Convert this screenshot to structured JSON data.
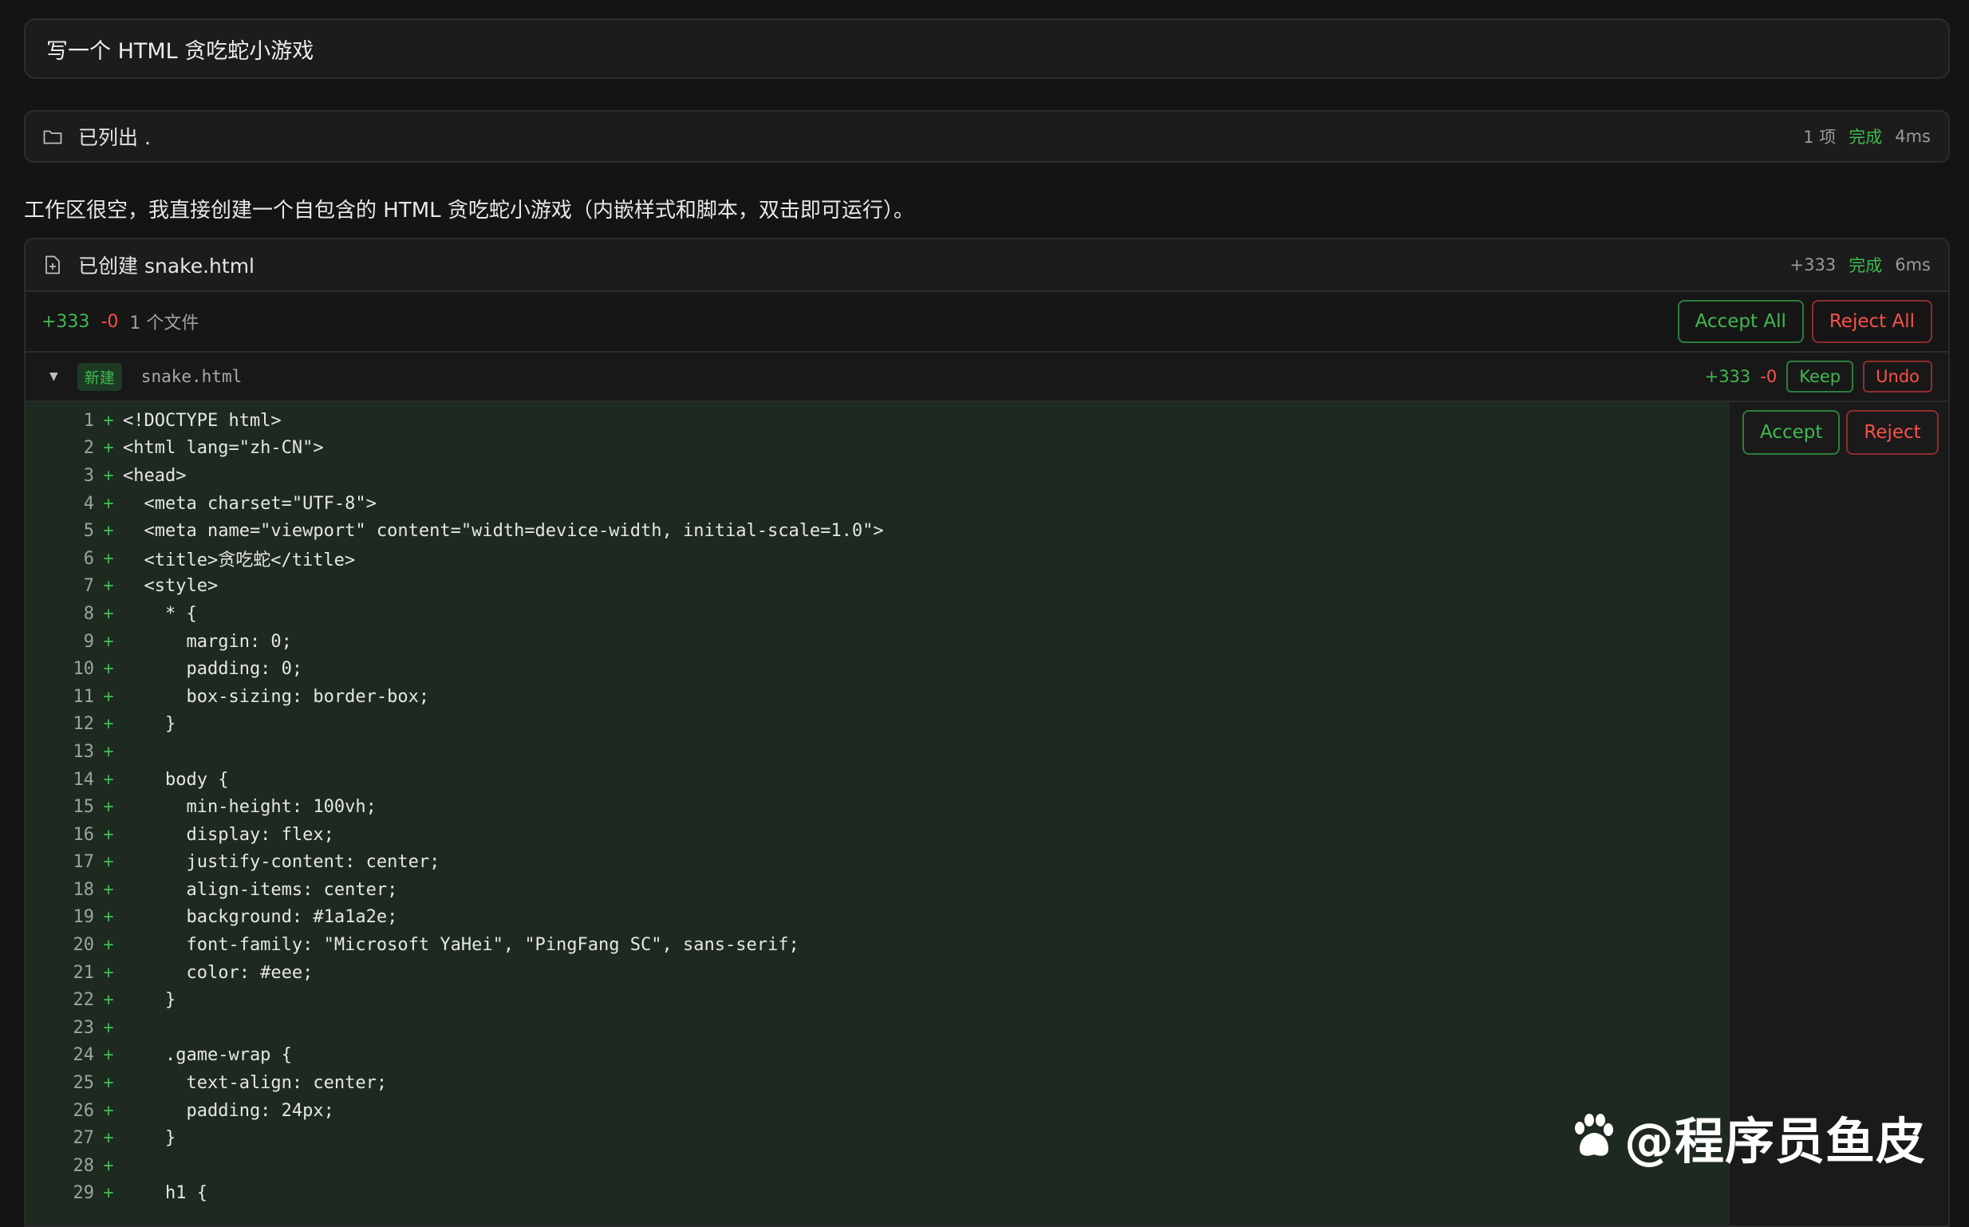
{
  "prompt": {
    "text": "写一个 HTML 贪吃蛇小游戏"
  },
  "list_tool": {
    "icon": "folder-icon",
    "label": "已列出 .",
    "count": "1 项",
    "status": "完成",
    "duration": "4ms"
  },
  "assistant_message": "工作区很空，我直接创建一个自包含的 HTML 贪吃蛇小游戏（内嵌样式和脚本，双击即可运行）。",
  "create_tool": {
    "icon": "file-plus-icon",
    "label": "已创建 snake.html",
    "added": "+333",
    "status": "完成",
    "duration": "6ms"
  },
  "summary": {
    "added": "+333",
    "removed": "-0",
    "files": "1 个文件",
    "accept_all": "Accept All",
    "reject_all": "Reject All"
  },
  "file": {
    "badge": "新建",
    "name": "snake.html",
    "added": "+333",
    "removed": "-0",
    "keep": "Keep",
    "undo": "Undo"
  },
  "hunk": {
    "accept": "Accept",
    "reject": "Reject"
  },
  "code_lines": [
    "<!DOCTYPE html>",
    "<html lang=\"zh-CN\">",
    "<head>",
    "  <meta charset=\"UTF-8\">",
    "  <meta name=\"viewport\" content=\"width=device-width, initial-scale=1.0\">",
    "  <title>贪吃蛇</title>",
    "  <style>",
    "    * {",
    "      margin: 0;",
    "      padding: 0;",
    "      box-sizing: border-box;",
    "    }",
    "",
    "    body {",
    "      min-height: 100vh;",
    "      display: flex;",
    "      justify-content: center;",
    "      align-items: center;",
    "      background: #1a1a2e;",
    "      font-family: \"Microsoft YaHei\", \"PingFang SC\", sans-serif;",
    "      color: #eee;",
    "    }",
    "",
    "    .game-wrap {",
    "      text-align: center;",
    "      padding: 24px;",
    "    }",
    "",
    "    h1 {"
  ],
  "watermark": "@程序员鱼皮"
}
